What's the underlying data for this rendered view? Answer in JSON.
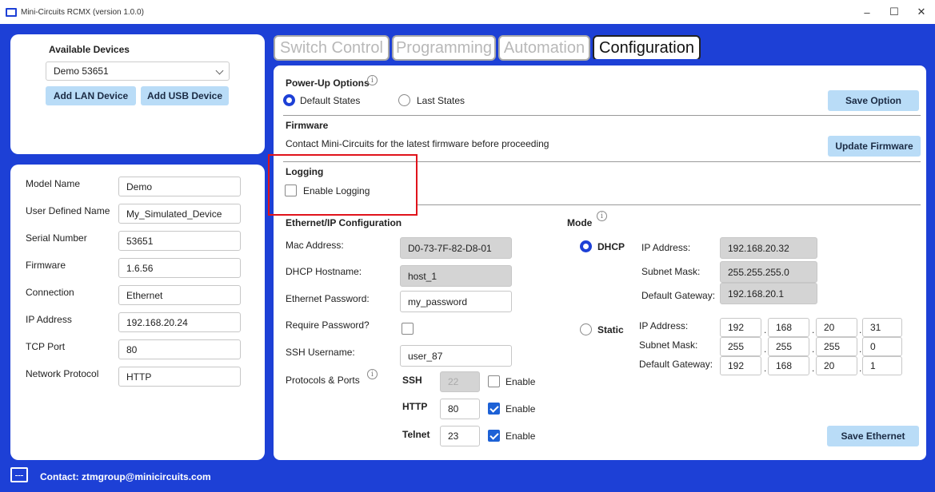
{
  "window": {
    "title": "Mini-Circuits RCMX (version 1.0.0)",
    "minimize": "–",
    "maximize": "☐",
    "close": "✕"
  },
  "devices": {
    "heading": "Available Devices",
    "selected": "Demo  53651",
    "add_lan": "Add LAN Device",
    "add_usb": "Add USB Device"
  },
  "info": {
    "rows": [
      {
        "label": "Model Name",
        "value": "Demo"
      },
      {
        "label": "User Defined Name",
        "value": "My_Simulated_Device"
      },
      {
        "label": "Serial Number",
        "value": "53651"
      },
      {
        "label": "Firmware",
        "value": "1.6.56"
      },
      {
        "label": "Connection",
        "value": "Ethernet"
      },
      {
        "label": "IP Address",
        "value": "192.168.20.24"
      },
      {
        "label": "TCP Port",
        "value": "80"
      },
      {
        "label": "Network Protocol",
        "value": "HTTP"
      }
    ]
  },
  "tabs": [
    "Switch Control",
    "Programming",
    "Automation",
    "Configuration"
  ],
  "active_tab": "Configuration",
  "powerup": {
    "heading": "Power-Up Options",
    "default_states": "Default States",
    "last_states": "Last States",
    "selected": "Default States",
    "save": "Save Option"
  },
  "firmware": {
    "heading": "Firmware",
    "note": "Contact Mini-Circuits for the latest firmware before proceeding",
    "update": "Update Firmware"
  },
  "logging": {
    "heading": "Logging",
    "enable": "Enable Logging",
    "enabled": false
  },
  "ethernet": {
    "heading": "Ethernet/IP Configuration",
    "mac_label": "Mac Address:",
    "mac_value": "D0-73-7F-82-D8-01",
    "hostname_label": "DHCP Hostname:",
    "hostname_value": "host_1",
    "password_label": "Ethernet Password:",
    "password_value": "my_password",
    "require_label": "Require Password?",
    "require_checked": false,
    "ssh_user_label": "SSH Username:",
    "ssh_user_value": "user_87",
    "protocols_label": "Protocols & Ports",
    "protocols": [
      {
        "name": "SSH",
        "port": "22",
        "enable": "Enable",
        "enabled": false
      },
      {
        "name": "HTTP",
        "port": "80",
        "enable": "Enable",
        "enabled": true
      },
      {
        "name": "Telnet",
        "port": "23",
        "enable": "Enable",
        "enabled": true
      }
    ],
    "save": "Save Ethernet"
  },
  "mode": {
    "heading": "Mode",
    "selected": "DHCP",
    "dhcp": {
      "label": "DHCP",
      "ip_label": "IP Address:",
      "ip_value": "192.168.20.32",
      "mask_label": "Subnet Mask:",
      "mask_value": "255.255.255.0",
      "gw_label": "Default Gateway:",
      "gw_value": "192.168.20.1"
    },
    "static": {
      "label": "Static",
      "ip_label": "IP Address:",
      "ip": [
        "192",
        "168",
        "20",
        "31"
      ],
      "mask_label": "Subnet Mask:",
      "mask": [
        "255",
        "255",
        "255",
        "0"
      ],
      "gw_label": "Default Gateway:",
      "gw": [
        "192",
        "168",
        "20",
        "1"
      ]
    }
  },
  "footer": {
    "contact": "Contact: ztmgroup@minicircuits.com"
  },
  "colors": {
    "background": "#1d40d6",
    "button": "#b9dcf7",
    "highlight": "#e0131b"
  }
}
